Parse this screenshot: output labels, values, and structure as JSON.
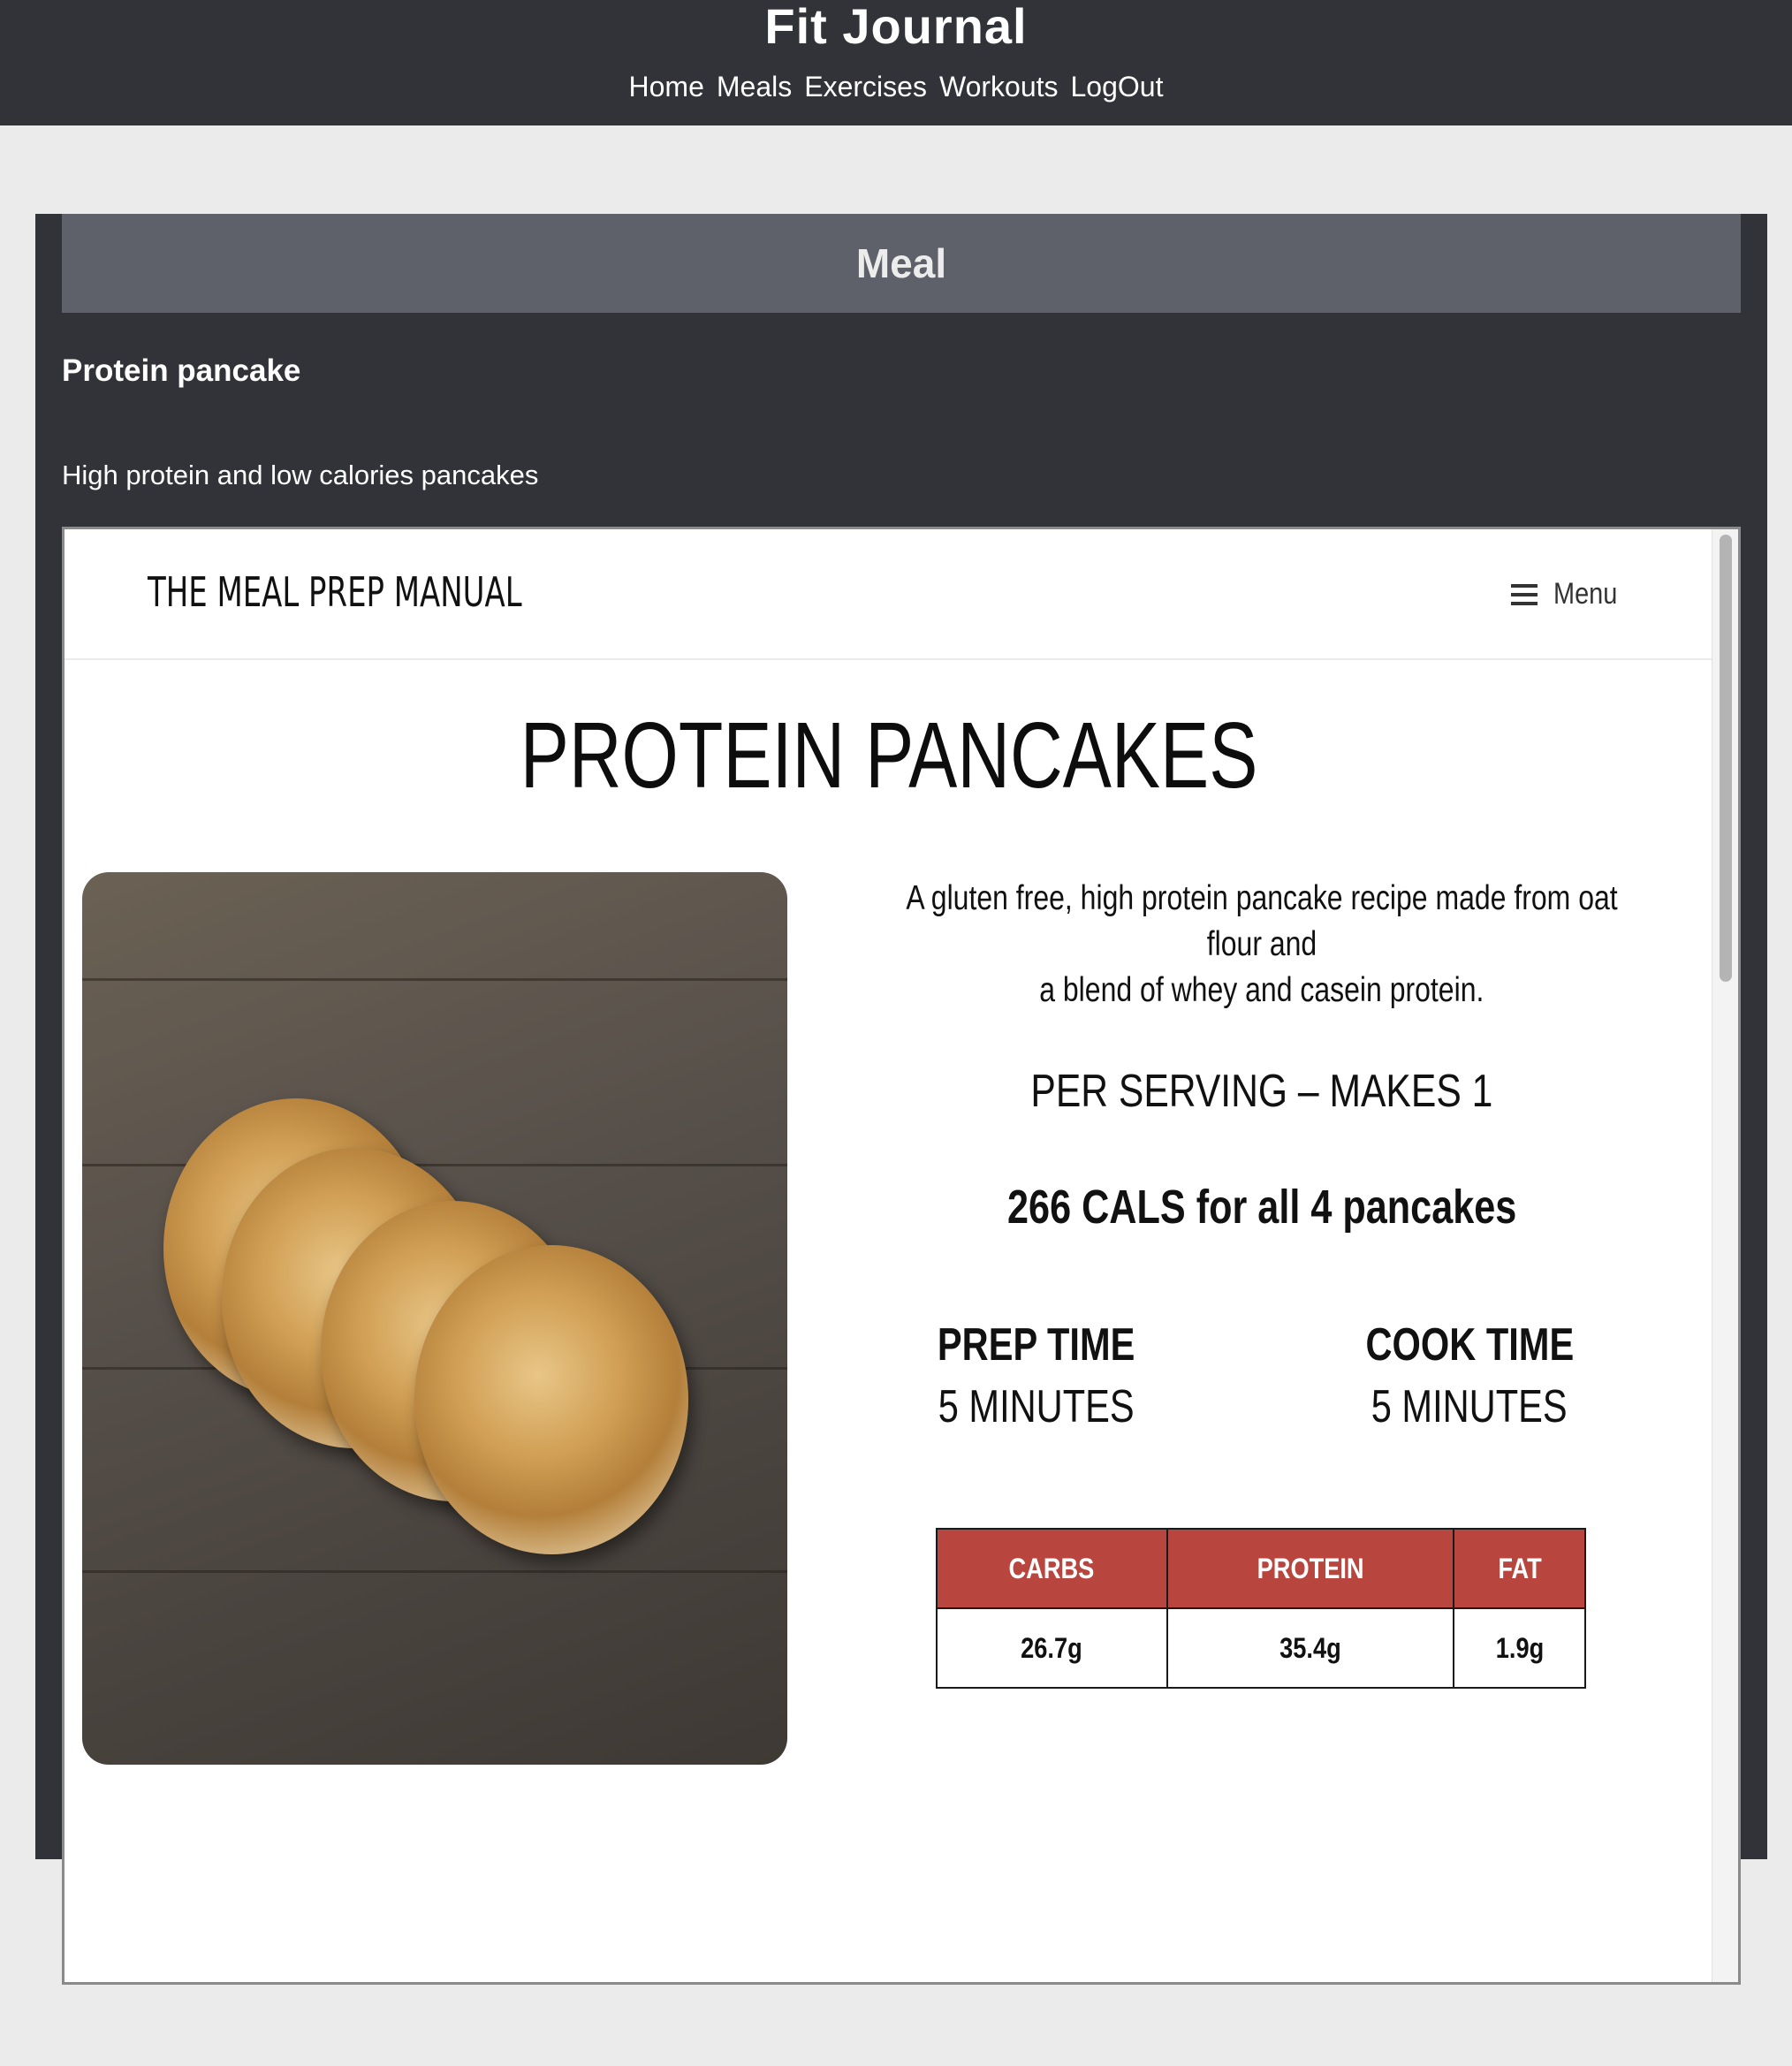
{
  "app": {
    "title": "Fit Journal",
    "nav": [
      "Home",
      "Meals",
      "Exercises",
      "Workouts",
      "LogOut"
    ]
  },
  "card": {
    "header": "Meal",
    "meal_name": "Protein pancake",
    "meal_description": "High protein and low calories pancakes"
  },
  "embedded_page": {
    "site_title": "THE MEAL PREP MANUAL",
    "menu_label": "Menu",
    "recipe_title": "PROTEIN PANCAKES",
    "intro_line1": "A gluten free, high protein pancake recipe made from oat flour and",
    "intro_line2": "a blend of whey and casein protein.",
    "serving": "PER SERVING – MAKES 1",
    "calories": "266 CALS for all 4 pancakes",
    "prep_time_label": "PREP TIME",
    "prep_time_value": "5 MINUTES",
    "cook_time_label": "COOK TIME",
    "cook_time_value": "5 MINUTES",
    "macros": {
      "headers": [
        "CARBS",
        "PROTEIN",
        "FAT"
      ],
      "values": [
        "26.7g",
        "35.4g",
        "1.9g"
      ]
    },
    "accent_color": "#b8463e"
  },
  "colors": {
    "navbar": "#323338",
    "card_header": "#5e6169",
    "page_bg": "#ebebeb"
  }
}
